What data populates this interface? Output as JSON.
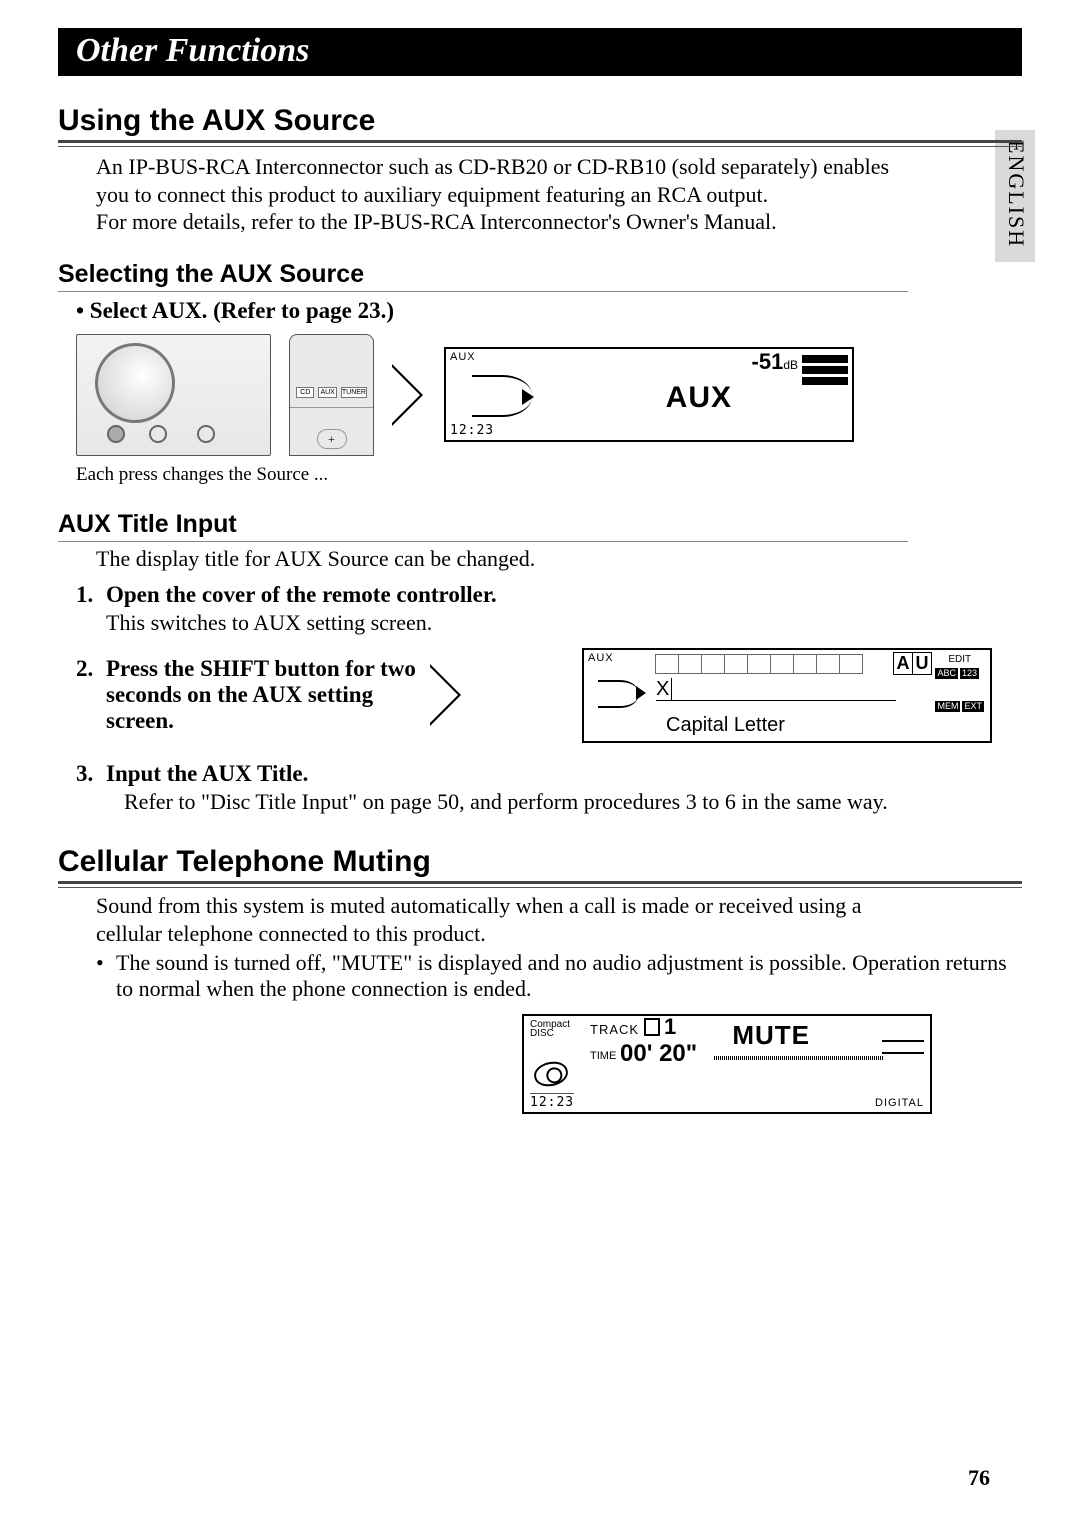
{
  "banner": "Other Functions",
  "language_tab": "ENGLISH",
  "page_number": "76",
  "aux": {
    "heading": "Using the AUX Source",
    "intro": "An IP-BUS-RCA Interconnector such as CD-RB20 or CD-RB10 (sold separately) enables you to connect this product to auxiliary equipment featuring an RCA output.\nFor more details, refer to the IP-BUS-RCA Interconnector's Owner's Manual.",
    "selecting_heading": "Selecting the AUX Source",
    "select_bullet": "•  Select AUX. (Refer to page 23.)",
    "remote_buttons": {
      "b1": "CD",
      "b2": "AUX",
      "b3": "TUNER"
    },
    "screen1": {
      "tag": "AUX",
      "db": "-51",
      "db_unit": "dB",
      "main": "AUX",
      "time": "12:23"
    },
    "caption": "Each press changes the Source ..."
  },
  "title_input": {
    "heading": "AUX Title Input",
    "intro": "The display title for AUX Source can be changed.",
    "steps": [
      {
        "num": "1.",
        "bold": "Open the cover of the remote controller.",
        "sub": "This switches to AUX setting screen."
      },
      {
        "num": "2.",
        "bold": "Press the SHIFT button for two seconds on the AUX setting screen."
      },
      {
        "num": "3.",
        "bold": "Input the AUX Title.",
        "sub": "Refer to \"Disc Title Input\" on page 50, and perform procedures 3 to 6 in the same way."
      }
    ],
    "screen2": {
      "tag": "AUX",
      "au": [
        "A",
        "U"
      ],
      "edit": "EDIT",
      "abc": "ABC",
      "n123": "123",
      "mem": "MEM",
      "ext": "EXT",
      "entry": "X",
      "cap": "Capital Letter"
    }
  },
  "cell": {
    "heading": "Cellular Telephone Muting",
    "body": "Sound from this system is muted automatically when a call is made or received using a cellular telephone connected to this product.",
    "bullet": "The sound is turned off, \"MUTE\" is displayed and no audio adjustment is possible. Operation returns to normal when the phone connection is ended.",
    "screen3": {
      "cd1": "Compact",
      "cd2": "DISC",
      "track_label": "TRACK",
      "track_num": "1",
      "mute": "MUTE",
      "time_label": "TIME",
      "time_val": "00' 20\"",
      "clock": "12:23",
      "digital": "DIGITAL"
    }
  }
}
